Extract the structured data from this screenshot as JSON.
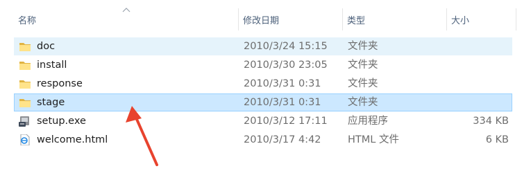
{
  "columns": {
    "name": "名称",
    "modified": "修改日期",
    "type": "类型",
    "size": "大小"
  },
  "files": [
    {
      "name": "doc",
      "modified": "2010/3/24 15:15",
      "type": "文件夹",
      "size": "",
      "icon": "folder-icon",
      "state": "hover"
    },
    {
      "name": "install",
      "modified": "2010/3/30 23:05",
      "type": "文件夹",
      "size": "",
      "icon": "folder-icon",
      "state": ""
    },
    {
      "name": "response",
      "modified": "2010/3/31 0:31",
      "type": "文件夹",
      "size": "",
      "icon": "folder-icon",
      "state": ""
    },
    {
      "name": "stage",
      "modified": "2010/3/31 0:31",
      "type": "文件夹",
      "size": "",
      "icon": "folder-icon",
      "state": "selected"
    },
    {
      "name": "setup.exe",
      "modified": "2010/3/12 17:11",
      "type": "应用程序",
      "size": "334 KB",
      "icon": "setup-exe-icon",
      "state": ""
    },
    {
      "name": "welcome.html",
      "modified": "2010/3/17 4:42",
      "type": "HTML 文件",
      "size": "6 KB",
      "icon": "html-file-icon",
      "state": ""
    }
  ],
  "colors": {
    "selected_bg": "#cce8ff",
    "selected_border": "#99d1ff",
    "hover_bg": "#e5f3fb",
    "folder": "#f8d775",
    "annotation_arrow": "#e8432e"
  }
}
